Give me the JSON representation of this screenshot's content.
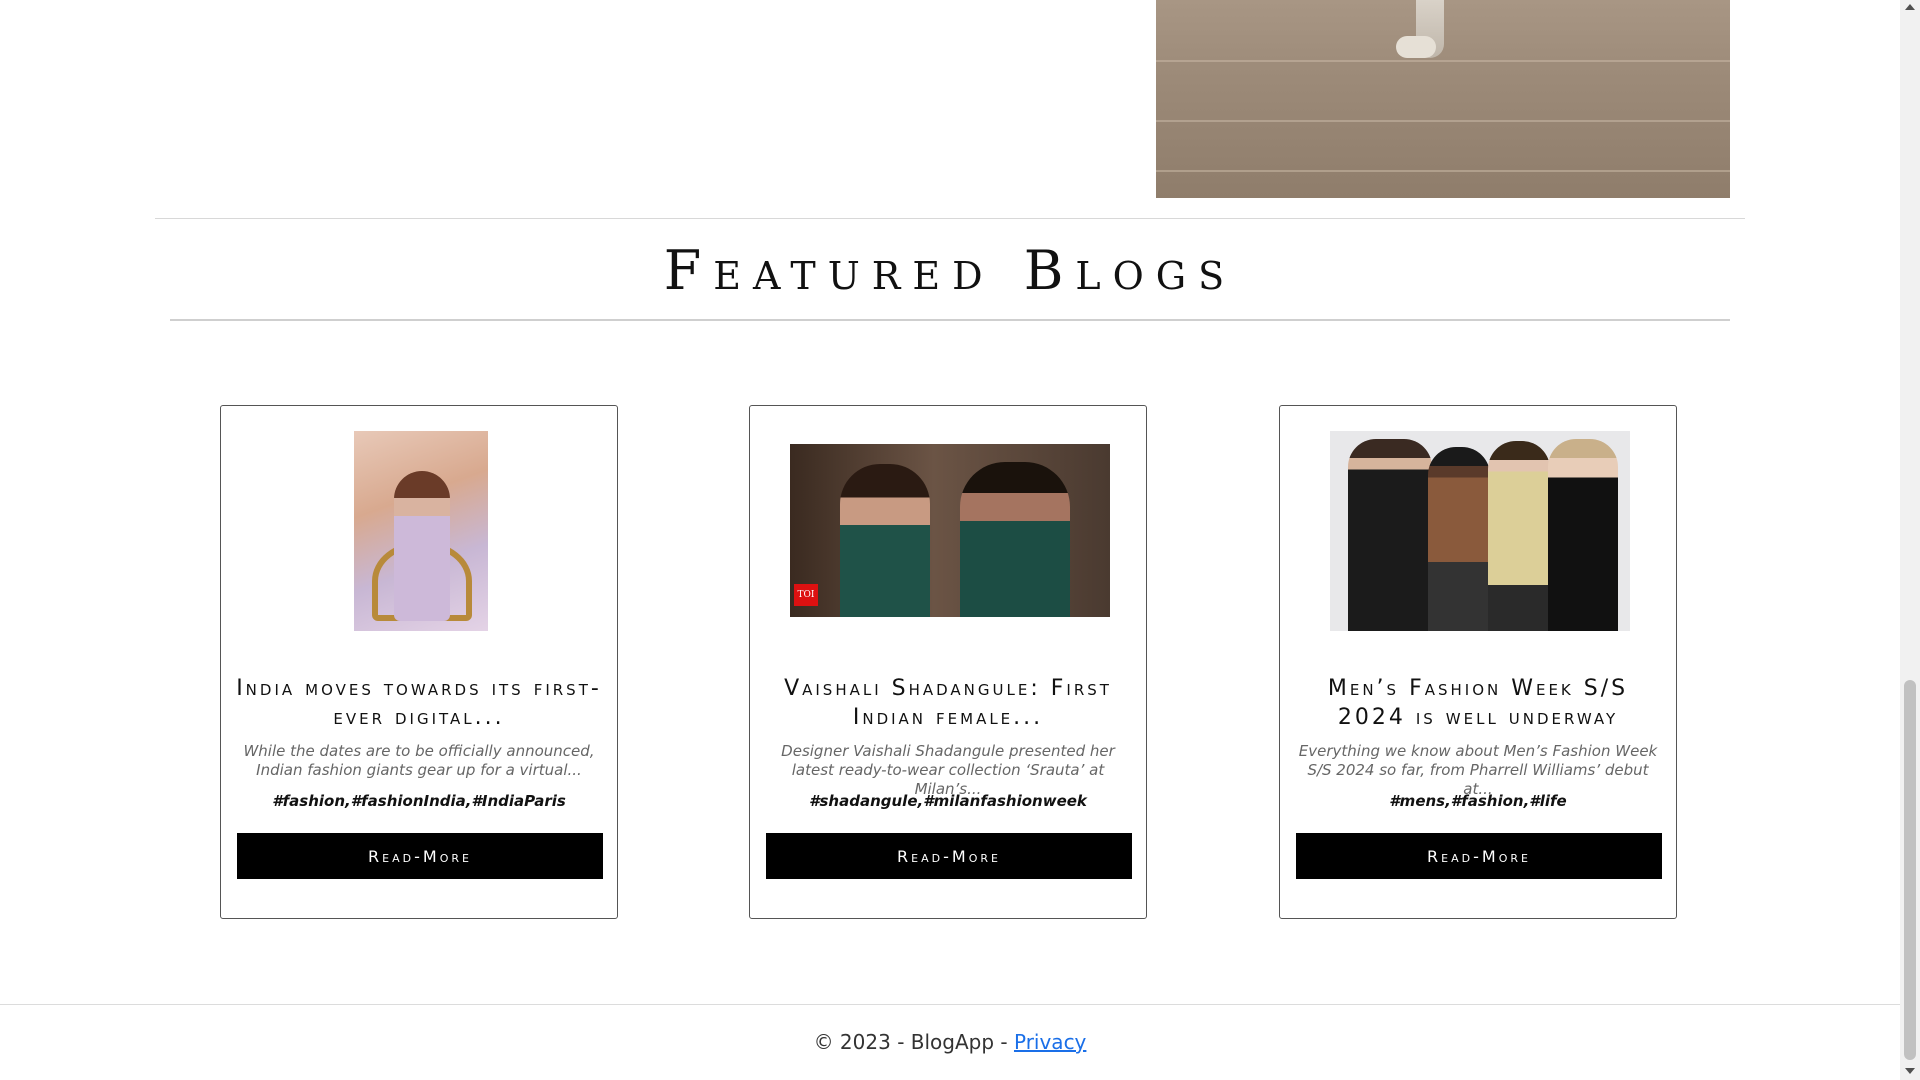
{
  "section": {
    "title": "Featured Blogs"
  },
  "cards": [
    {
      "title": "India moves towards its first-ever digital...",
      "description": "While the dates are to be officially announced, Indian fashion giants gear up for a virtual...",
      "tags": "#fashion,#fashionIndia,#IndiaParis",
      "button": "Read-More"
    },
    {
      "title": "Vaishali Shadangule: First Indian female...",
      "description": "Designer Vaishali Shadangule presented her latest ready-to-wear collection ‘Srauta’ at Milan’s...",
      "tags": "#shadangule,#milanfashionweek",
      "button": "Read-More",
      "image_badge": "TOI"
    },
    {
      "title": "Men’s Fashion Week S/S 2024 is well underway",
      "description": "Everything we know about Men’s Fashion Week S/S 2024 so far, from Pharrell Williams’ debut at...",
      "tags": "#mens,#fashion,#life",
      "button": "Read-More"
    }
  ],
  "footer": {
    "copyright": "© 2023 - BlogApp - ",
    "privacy_link": "Privacy"
  }
}
